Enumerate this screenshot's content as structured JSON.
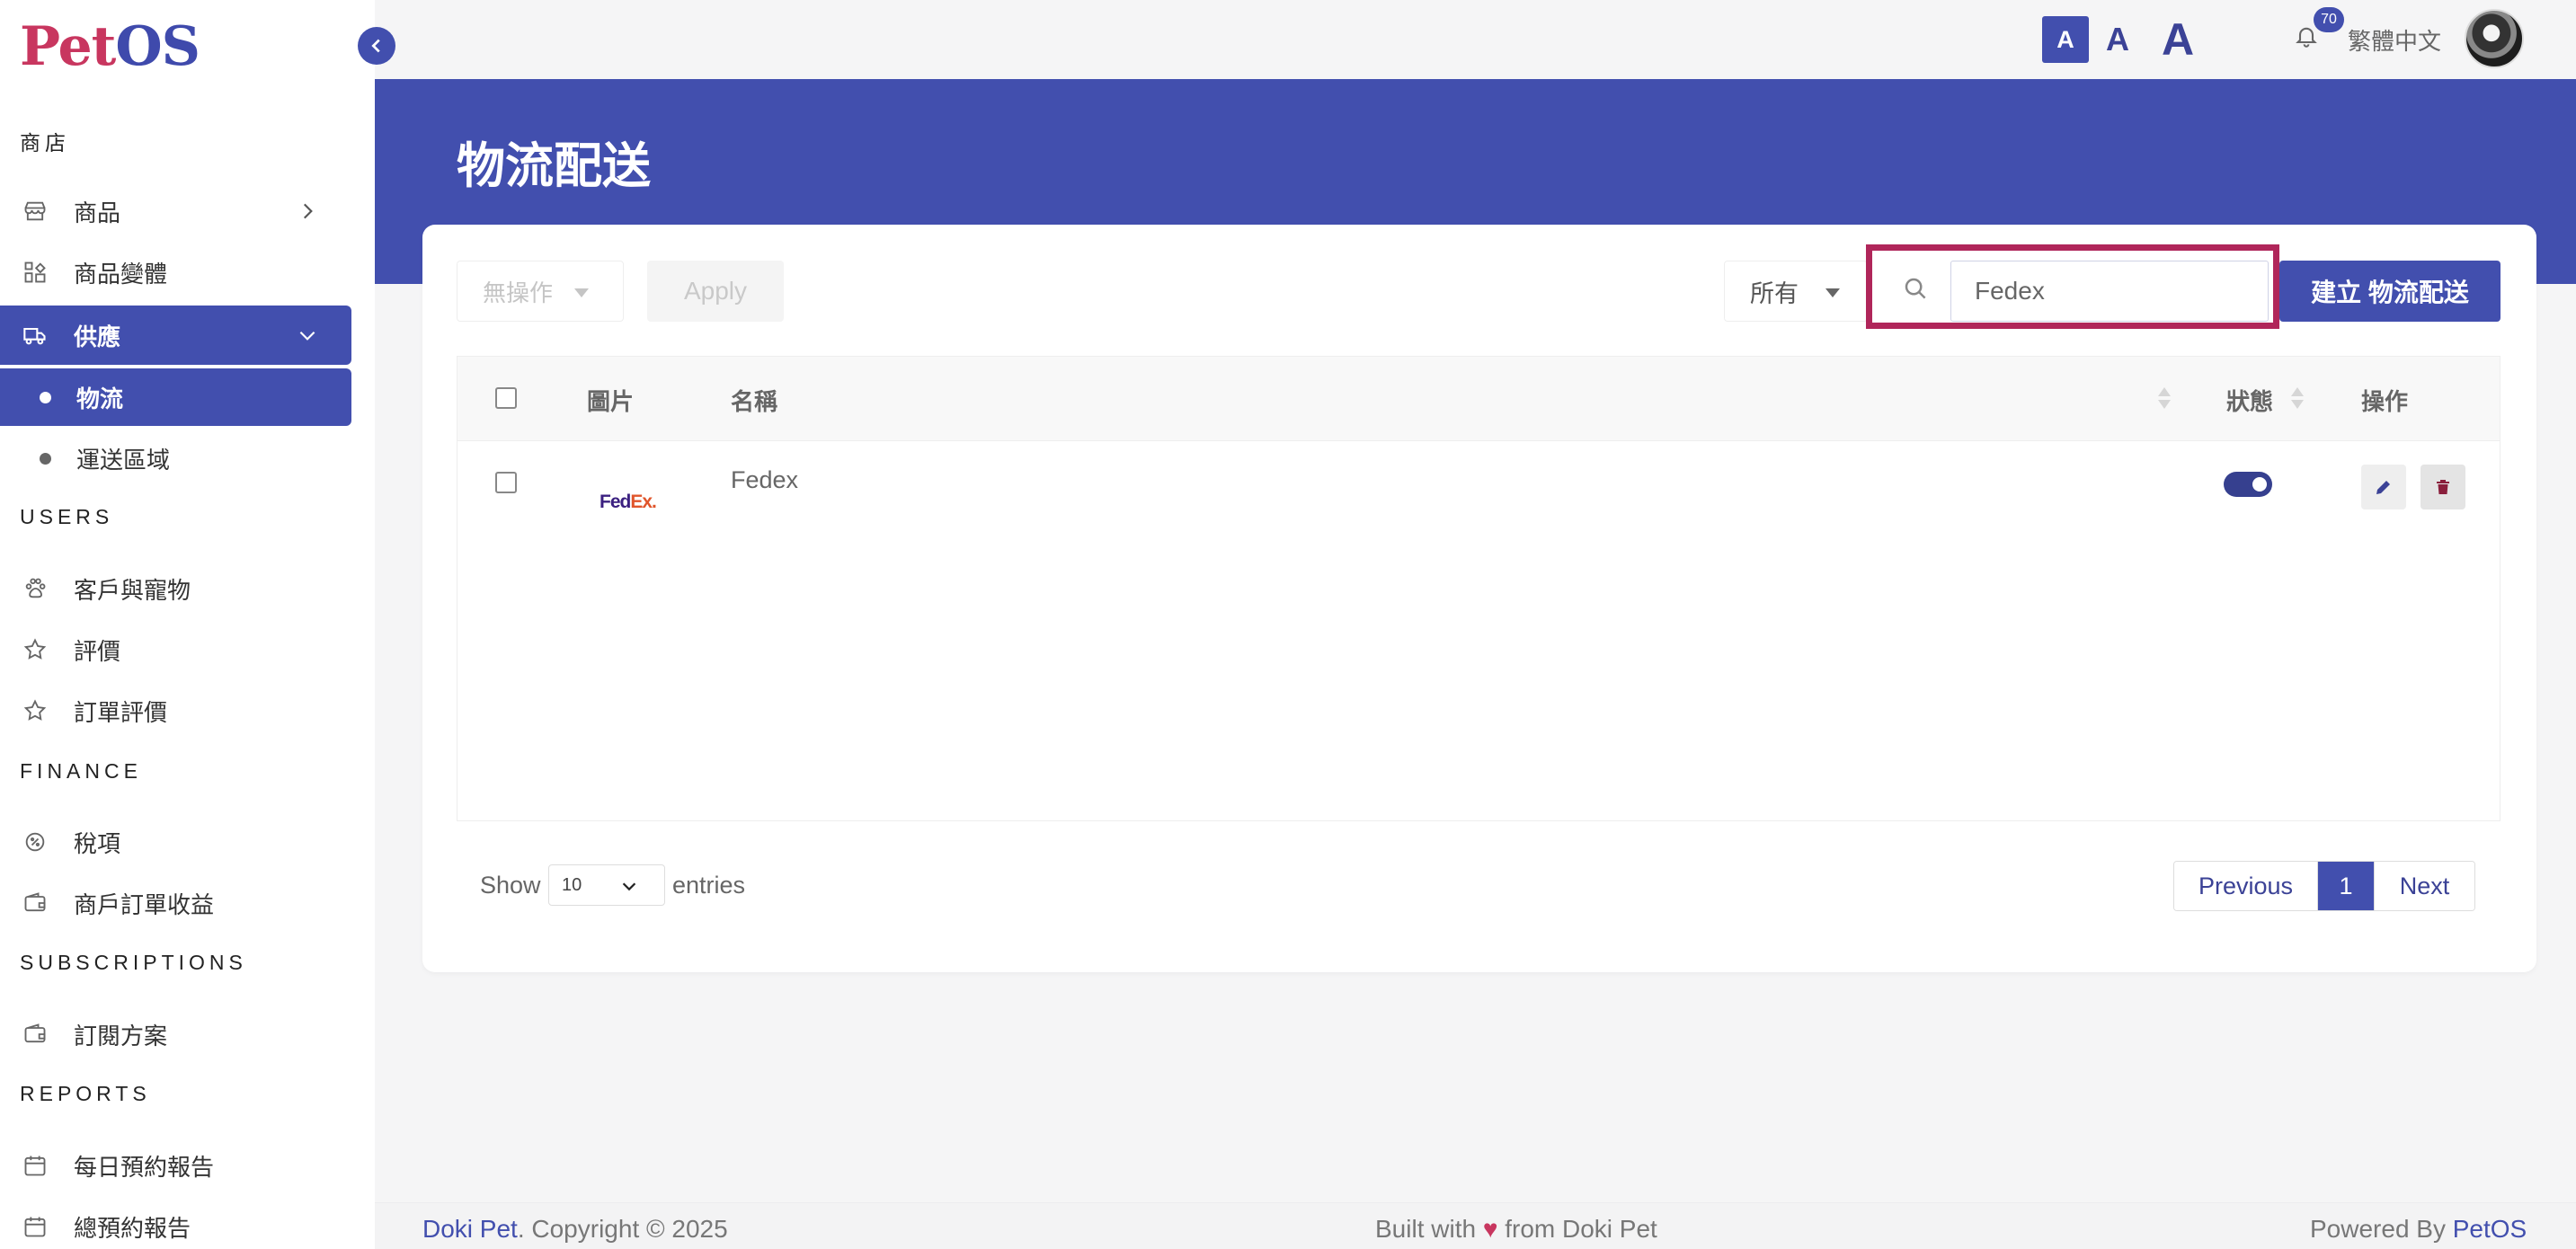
{
  "brand": {
    "logo_part1": "Pet",
    "logo_part2": "OS"
  },
  "sidebar": {
    "sections": {
      "shop": "商店",
      "users": "USERS",
      "finance": "FINANCE",
      "subscriptions": "SUBSCRIPTIONS",
      "reports": "REPORTS"
    },
    "items": {
      "products": "商品",
      "variants": "商品變體",
      "supply": "供應",
      "logistics": "物流",
      "shipping_zones": "運送區域",
      "customers_pets": "客戶與寵物",
      "reviews": "評價",
      "order_reviews": "訂單評價",
      "tax": "稅項",
      "merchant_revenue": "商戶訂單收益",
      "plans": "訂閱方案",
      "daily_report": "每日預約報告",
      "total_report": "總預約報告"
    }
  },
  "topbar": {
    "font_small": "A",
    "font_medium": "A",
    "font_large": "A",
    "notification_count": "70",
    "language": "繁體中文"
  },
  "page": {
    "title": "物流配送"
  },
  "toolbar": {
    "bulk_action": "無操作",
    "apply": "Apply",
    "status_filter": "所有",
    "search_value": "Fedex",
    "create": "建立 物流配送"
  },
  "table": {
    "headers": {
      "image": "圖片",
      "name": "名稱",
      "status": "狀態",
      "actions": "操作"
    },
    "rows": [
      {
        "logo_fed": "Fed",
        "logo_ex": "Ex.",
        "name": "Fedex",
        "status_on": true
      }
    ]
  },
  "footer_controls": {
    "show": "Show",
    "page_length": "10",
    "entries": "entries",
    "previous": "Previous",
    "page": "1",
    "next": "Next"
  },
  "page_footer": {
    "brand_name": "Doki Pet",
    "copyright": ". Copyright © 2025",
    "built_prefix": "Built with",
    "built_suffix": "from Doki Pet",
    "powered_prefix": "Powered By",
    "powered_brand": "PetOS"
  },
  "colors": {
    "primary": "#424fae",
    "accent": "#c8365f",
    "highlight": "#b0265a"
  }
}
